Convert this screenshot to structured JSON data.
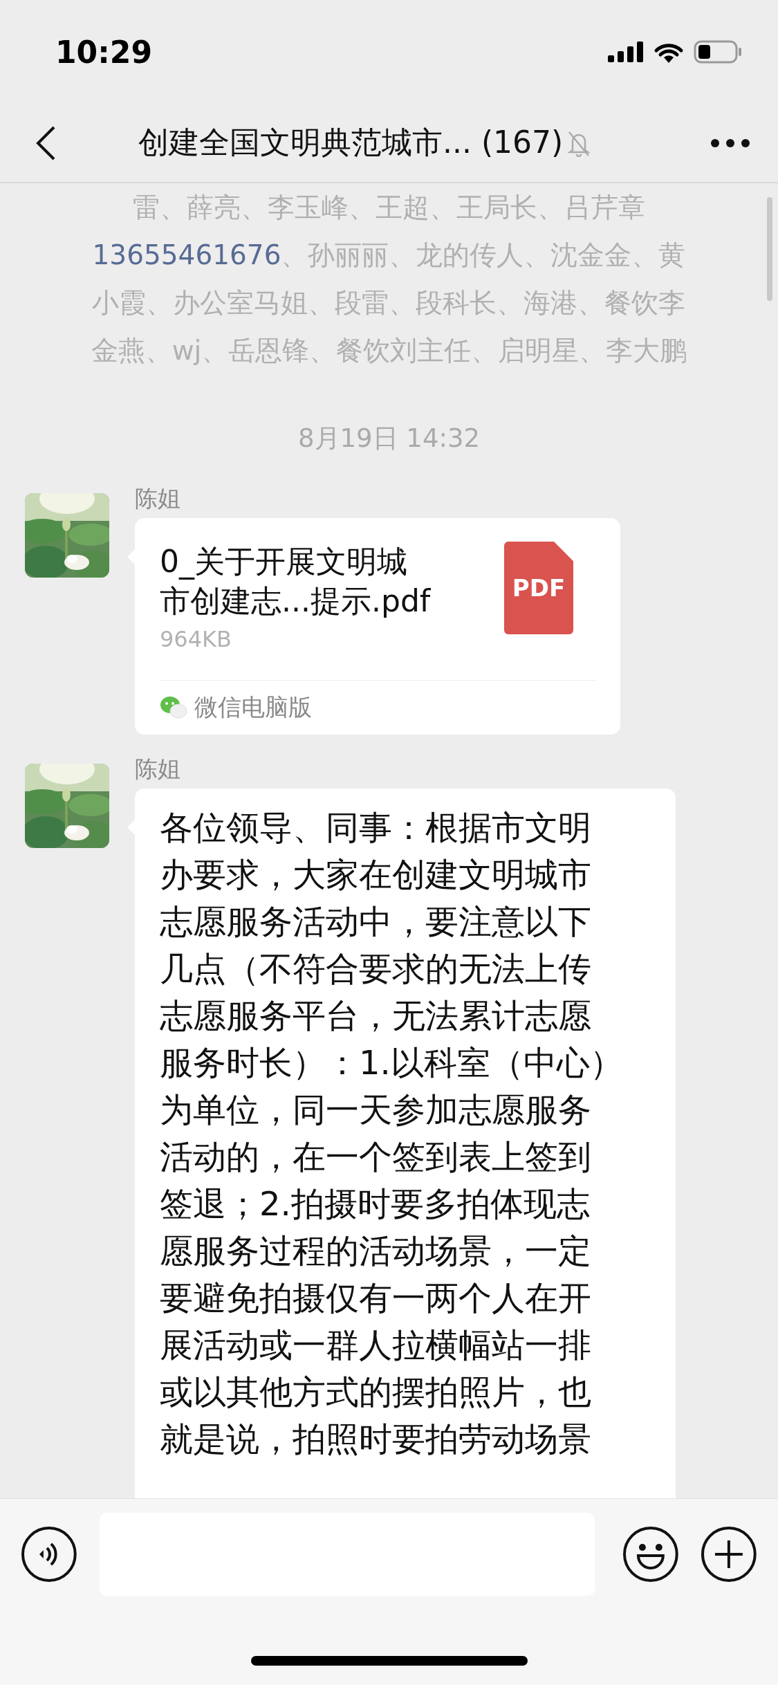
{
  "status_bar": {
    "time": "10:29"
  },
  "nav": {
    "title": "创建全国文明典范城市... (167)",
    "muted": true
  },
  "members": {
    "lines": [
      {
        "text": "雷、薛亮、李玉峰、王超、王局长、吕芹章"
      },
      {
        "link": "13655461676",
        "text": "、孙丽丽、龙的传人、沈金金、黄"
      },
      {
        "text": "小霞、办公室马姐、段雷、段科长、海港、餐饮李"
      },
      {
        "text": "金燕、wj、岳恩锋、餐饮刘主任、启明星、李大鹏"
      }
    ]
  },
  "timestamp": "8月19日 14:32",
  "messages": [
    {
      "kind": "file",
      "sender": "陈姐",
      "name_lines": [
        "0_关于开展文明城",
        "市创建志...提示.pdf"
      ],
      "size": "964KB",
      "icon_label": "PDF",
      "source": "微信电脑版"
    },
    {
      "kind": "text",
      "sender": "陈姐",
      "lines": [
        "各位领导、同事：根据市文明",
        "办要求，大家在创建文明城市",
        "志愿服务活动中，要注意以下",
        "几点（不符合要求的无法上传",
        "志愿服务平台，无法累计志愿",
        "服务时长）：1.以科室（中心）",
        "为单位，同一天参加志愿服务",
        "活动的，在一个签到表上签到",
        "签退；2.拍摄时要多拍体现志",
        "愿服务过程的活动场景，一定",
        "要避免拍摄仅有一两个人在开",
        "展活动或一群人拉横幅站一排",
        "或以其他方式的摆拍照片，也",
        "就是说，拍照时要拍劳动场景"
      ]
    }
  ]
}
